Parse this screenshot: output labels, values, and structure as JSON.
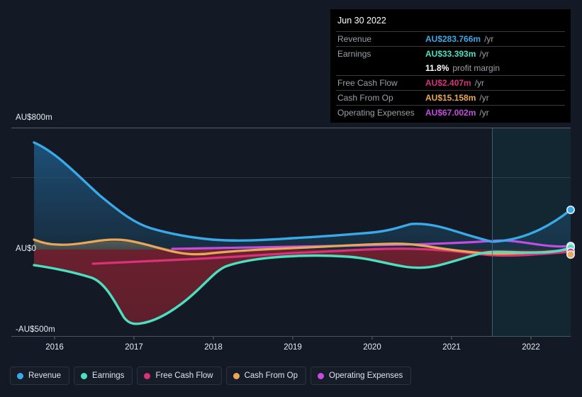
{
  "tooltip": {
    "date": "Jun 30 2022",
    "rows": [
      {
        "name": "Revenue",
        "value": "AU$283.766m",
        "unit": "/yr",
        "color": "#3aa9e8"
      },
      {
        "name": "Earnings",
        "value": "AU$33.393m",
        "unit": "/yr",
        "color": "#4ae0c0"
      },
      {
        "name": "Free Cash Flow",
        "value": "AU$2.407m",
        "unit": "/yr",
        "color": "#d9317a"
      },
      {
        "name": "Cash From Op",
        "value": "AU$15.158m",
        "unit": "/yr",
        "color": "#e8a857"
      },
      {
        "name": "Operating Expenses",
        "value": "AU$67.002m",
        "unit": "/yr",
        "color": "#c44ce0"
      }
    ],
    "sub_row": {
      "value": "11.8%",
      "text": "profit margin"
    }
  },
  "axes": {
    "y_top": "AU$800m",
    "y_zero": "AU$0",
    "y_bottom": "-AU$500m",
    "x_ticks": [
      "2016",
      "2017",
      "2018",
      "2019",
      "2020",
      "2021",
      "2022"
    ]
  },
  "legend": [
    {
      "label": "Revenue",
      "color": "#3aa9e8"
    },
    {
      "label": "Earnings",
      "color": "#4ae0c0"
    },
    {
      "label": "Free Cash Flow",
      "color": "#d9317a"
    },
    {
      "label": "Cash From Op",
      "color": "#e8a857"
    },
    {
      "label": "Operating Expenses",
      "color": "#c44ce0"
    }
  ],
  "chart_data": {
    "type": "area",
    "title": "",
    "xlabel": "",
    "ylabel": "AU$",
    "ylim": [
      -500,
      800
    ],
    "xlim": [
      2015.6,
      2022.45
    ],
    "grid": true,
    "currency": "AU$",
    "units": "millions",
    "legend_position": "bottom",
    "forecast_divider_x": 2021.55,
    "x": [
      2015.62,
      2016.0,
      2016.5,
      2017.0,
      2017.5,
      2018.0,
      2018.5,
      2019.0,
      2019.5,
      2020.0,
      2020.5,
      2021.0,
      2021.5,
      2022.0,
      2022.42
    ],
    "series": [
      {
        "name": "Revenue",
        "color": "#3aa9e8",
        "values": [
          790,
          690,
          500,
          380,
          320,
          285,
          288,
          292,
          296,
          300,
          312,
          300,
          282,
          280,
          284
        ]
      },
      {
        "name": "Earnings",
        "color": "#4ae0c0",
        "values": [
          -90,
          -130,
          -300,
          -485,
          -470,
          -210,
          -80,
          -45,
          -35,
          -45,
          -95,
          -80,
          -20,
          12,
          33
        ]
      },
      {
        "name": "Free Cash Flow",
        "color": "#d9317a",
        "values": [
          null,
          null,
          -55,
          -55,
          -50,
          -40,
          -20,
          -10,
          -5,
          5,
          8,
          6,
          -12,
          -8,
          2
        ]
      },
      {
        "name": "Cash From Op",
        "color": "#e8a857",
        "values": [
          75,
          45,
          55,
          60,
          40,
          5,
          -10,
          2,
          8,
          14,
          28,
          30,
          8,
          6,
          15
        ]
      },
      {
        "name": "Operating Expenses",
        "color": "#c44ce0",
        "values": [
          null,
          null,
          null,
          null,
          8,
          10,
          12,
          15,
          18,
          22,
          26,
          30,
          42,
          56,
          67
        ]
      }
    ],
    "endpoint_markers": [
      {
        "name": "Revenue",
        "value": 283.766
      },
      {
        "name": "Operating Expenses",
        "value": 67.002
      },
      {
        "name": "Earnings",
        "value": 33.393
      },
      {
        "name": "Cash From Op",
        "value": 15.158
      },
      {
        "name": "Free Cash Flow",
        "value": 2.407
      }
    ]
  }
}
